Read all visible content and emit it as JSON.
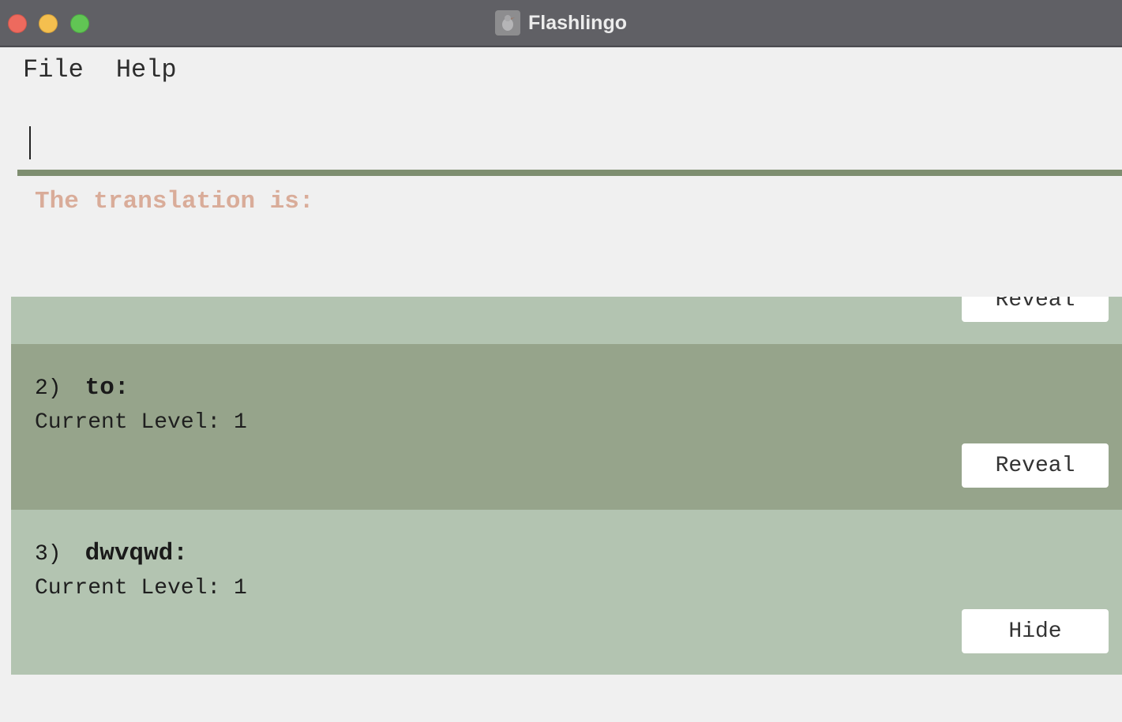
{
  "window": {
    "title": "Flashlingo",
    "app_icon": "flashlingo-app-icon"
  },
  "menu": {
    "items": [
      "File",
      "Help"
    ]
  },
  "command": {
    "value": "",
    "placeholder": ""
  },
  "result": {
    "label": "The translation is:"
  },
  "flashcards": [
    {
      "index": "",
      "word": "",
      "level": "",
      "button": "Reveal"
    },
    {
      "index": "2)",
      "word": "to:",
      "level": "Current Level: 1",
      "button": "Reveal"
    },
    {
      "index": "3)",
      "word": "dwvqwd:",
      "level": "Current Level: 1",
      "button": "Hide"
    }
  ],
  "colors": {
    "card_light": "#b3c4b1",
    "card_dark": "#96a48b",
    "result_label": "#d9ac99",
    "divider": "#7e8e70"
  }
}
